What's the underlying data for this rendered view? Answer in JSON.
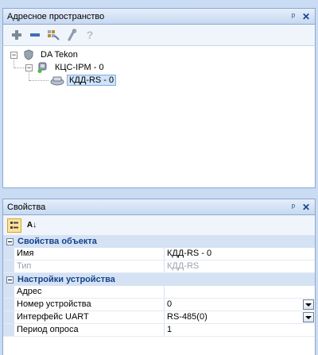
{
  "address_panel": {
    "title": "Адресное пространство",
    "pin_glyph": "ᵖ",
    "close_glyph": "✕",
    "toolbar": {
      "add_icon": "plus-icon",
      "remove_icon": "minus-icon",
      "properties_icon": "settings-icon",
      "edit_icon": "wrench-icon",
      "help_icon": "help-icon",
      "help_glyph": "?"
    },
    "tree": [
      {
        "label": "DA Tekon",
        "icon": "shield-icon",
        "expanded": true
      },
      {
        "label": "КЦС-IPM - 0",
        "icon": "network-device-icon",
        "expanded": true,
        "status_color": "#3ac33a"
      },
      {
        "label": "КДД-RS - 0",
        "icon": "modem-icon",
        "selected": true
      }
    ]
  },
  "properties_panel": {
    "title": "Свойства",
    "pin_glyph": "ᵖ",
    "close_glyph": "✕",
    "toolbar": {
      "categorized_icon": "categorized-icon",
      "alphabetical_icon": "sort-alpha-icon",
      "alpha_glyph": "A↓"
    },
    "categories": [
      {
        "name": "Свойства объекта",
        "rows": [
          {
            "name": "Имя",
            "value": "КДД-RS - 0",
            "disabled": false,
            "dropdown": false
          },
          {
            "name": "Тип",
            "value": "КДД-RS",
            "disabled": true,
            "dropdown": false
          }
        ]
      },
      {
        "name": "Настройки устройства",
        "rows": [
          {
            "name": "Адрес",
            "value": "",
            "disabled": false,
            "dropdown": false
          },
          {
            "name": "Номер устройства",
            "value": "0",
            "disabled": false,
            "dropdown": true
          },
          {
            "name": "Интерфейс UART",
            "value": "RS-485(0)",
            "disabled": false,
            "dropdown": true
          },
          {
            "name": "Период опроса",
            "value": "1",
            "disabled": false,
            "dropdown": false
          }
        ]
      }
    ]
  },
  "colors": {
    "accent": "#15428b",
    "selection": "#cfe3fa",
    "category_bg": "#d5e2f4",
    "frame_bg": "#c9dcf3"
  }
}
